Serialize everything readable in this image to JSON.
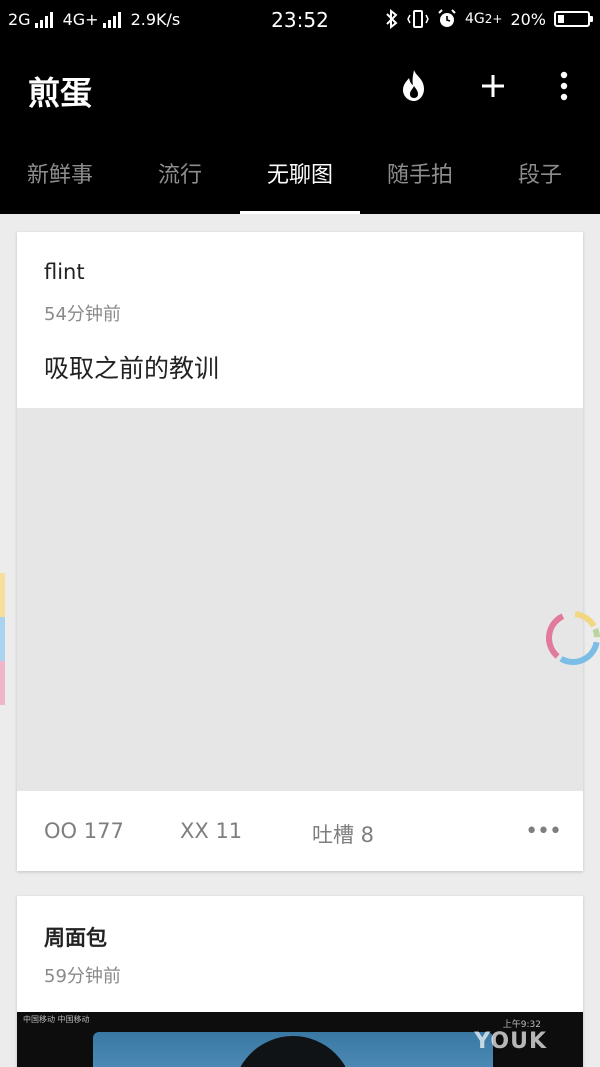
{
  "status_bar": {
    "network_left": "2G",
    "network_mid": "4G+",
    "speed": "2.9K/s",
    "time": "23:52",
    "network_right": "4G",
    "network_right_suffix": "2+",
    "battery_percent": "20%",
    "battery_level": 0.2
  },
  "app_bar": {
    "title": "煎蛋",
    "actions": [
      "fire-icon",
      "add-icon",
      "more-vert-icon"
    ]
  },
  "tabs": [
    {
      "label": "新鲜事",
      "active": false
    },
    {
      "label": "流行",
      "active": false
    },
    {
      "label": "无聊图",
      "active": true
    },
    {
      "label": "随手拍",
      "active": false
    },
    {
      "label": "段子",
      "active": false
    }
  ],
  "posts": [
    {
      "author": "flint",
      "time": "54分钟前",
      "text": "吸取之前的教训",
      "oo": "OO 177",
      "xx": "XX 11",
      "comments": "吐槽 8",
      "more": "•••"
    },
    {
      "author": "周面包",
      "time": "59分钟前",
      "video_watermark": "YOUK",
      "video_tiny_left": "中国移动 中国移动",
      "video_tiny_right": "上午9:32"
    }
  ],
  "colors": {
    "bar_bg": "#000000",
    "tab_active": "#ffffff",
    "tab_inactive": "#8d8d8d",
    "page_bg": "#ececec",
    "loader_pink": "#e27a9b",
    "loader_blue": "#7cbde6",
    "loader_yellow": "#f2d783",
    "loader_green": "#b9d6a2"
  }
}
